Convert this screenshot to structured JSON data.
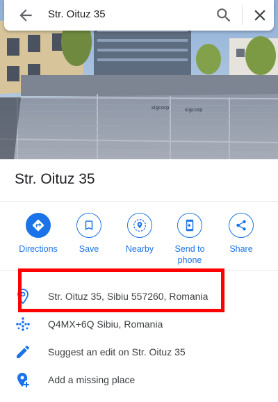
{
  "search": {
    "query": "Str. Oituz 35"
  },
  "place": {
    "title": "Str. Oituz 35"
  },
  "actions": [
    {
      "label": "Directions",
      "icon": "directions-icon"
    },
    {
      "label": "Save",
      "icon": "bookmark-icon"
    },
    {
      "label": "Nearby",
      "icon": "nearby-icon"
    },
    {
      "label": "Send to\nphone",
      "icon": "send-to-phone-icon"
    },
    {
      "label": "Share",
      "icon": "share-icon"
    }
  ],
  "details": {
    "address": "Str. Oituz 35, Sibiu 557260, Romania",
    "plus_code": "Q4MX+6Q Sibiu, Romania",
    "suggest_edit": "Suggest an edit on Str. Oituz 35",
    "add_place": "Add a missing place"
  },
  "photo": {
    "sign_text_1": "sigcorp",
    "sign_text_2": "sigcorp"
  },
  "colors": {
    "accent": "#1a73e8",
    "highlight": "#ff0000",
    "icon_gray": "#5f6368"
  }
}
